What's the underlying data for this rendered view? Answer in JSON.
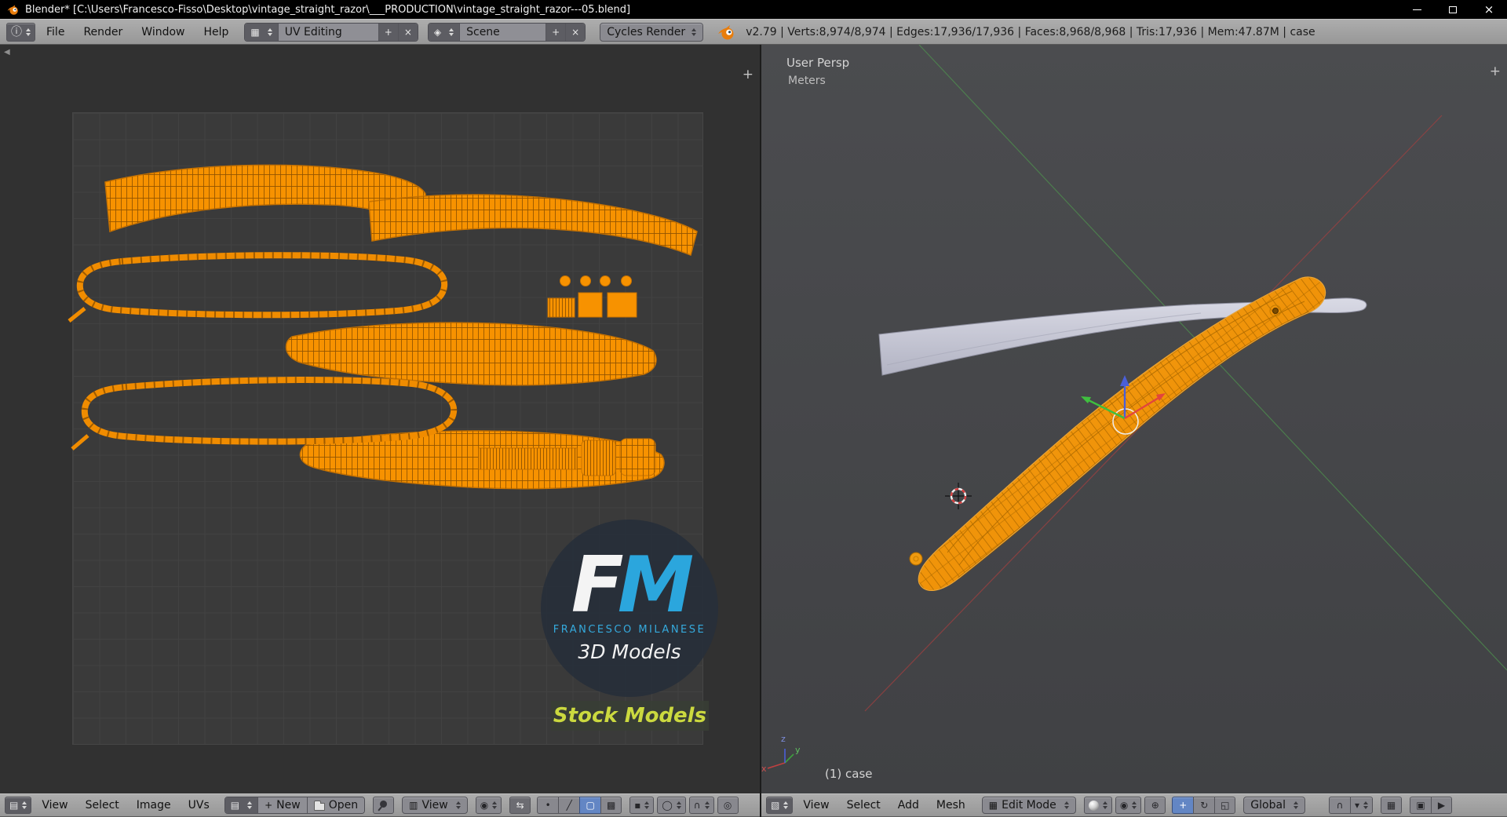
{
  "window": {
    "title": "Blender* [C:\\Users\\Francesco-Fisso\\Desktop\\vintage_straight_razor\\___PRODUCTION\\vintage_straight_razor---05.blend]"
  },
  "top_header": {
    "menus": [
      "File",
      "Render",
      "Window",
      "Help"
    ],
    "layout_name": "UV Editing",
    "scene_name": "Scene",
    "engine_name": "Cycles Render",
    "stats": "v2.79 | Verts:8,974/8,974 | Edges:17,936/17,936 | Faces:8,968/8,968 | Tris:17,936 | Mem:47.87M | case"
  },
  "uv_editor": {
    "menus": [
      "View",
      "Select",
      "Image",
      "UVs"
    ],
    "new_label": "New",
    "open_label": "Open",
    "mode_label": "View",
    "watermark": {
      "initial_f": "F",
      "initial_m": "M",
      "name": "FRANCESCO MILANESE",
      "tagline": "3D Models",
      "badge": "Stock Models"
    }
  },
  "viewport": {
    "view_label": "User Persp",
    "units_label": "Meters",
    "object_info": "(1) case",
    "menus": [
      "View",
      "Select",
      "Add",
      "Mesh"
    ],
    "mode_label": "Edit Mode",
    "orientation_label": "Global",
    "axes": {
      "x": "x",
      "y": "y",
      "z": "z"
    }
  },
  "colors": {
    "uv_orange": "#f79200",
    "selection_blue": "#6386c4",
    "watermark_blue": "#2ba6dd",
    "badge_green": "#cbd93f"
  }
}
